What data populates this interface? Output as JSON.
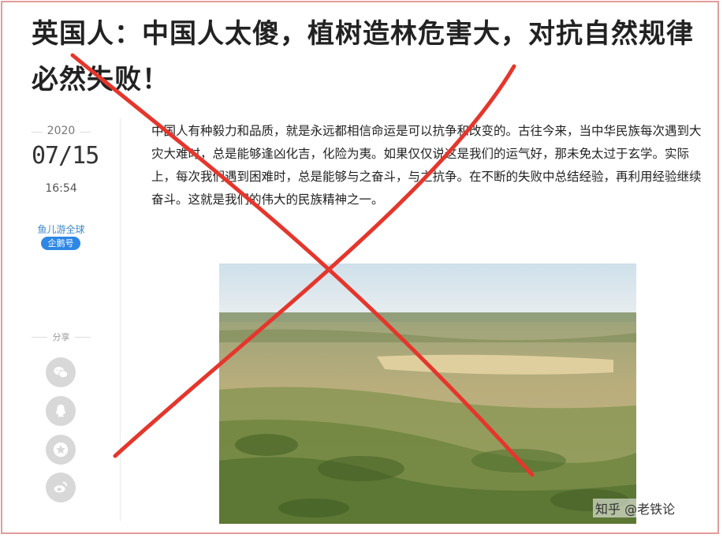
{
  "article": {
    "title": "英国人：中国人太傻，植树造林危害大，对抗自然规律必然失败！",
    "body": "中国人有种毅力和品质，就是永远都相信命运是可以抗争和改变的。古往今来，当中华民族每次遇到大灾大难时，总是能够逢凶化吉，化险为夷。如果仅仅说这是我们的运气好，那未免太过于玄学。实际上，每次我们遇到困难时，总是能够与之奋斗，与之抗争。在不断的失败中总结经验，再利用经验继续奋斗。这就是我们的伟大的民族精神之一。"
  },
  "meta": {
    "year": "2020",
    "date": "07/15",
    "time": "16:54",
    "author": "鱼儿游全球",
    "badge": "企鹅号"
  },
  "share": {
    "label": "分享",
    "buttons": [
      "wechat-icon",
      "qq-icon",
      "star-icon",
      "weibo-icon"
    ]
  },
  "watermark": "知乎 @老铁论",
  "colors": {
    "cross": "#e5362c",
    "badge": "#2d87e5",
    "author": "#3b86c9"
  }
}
